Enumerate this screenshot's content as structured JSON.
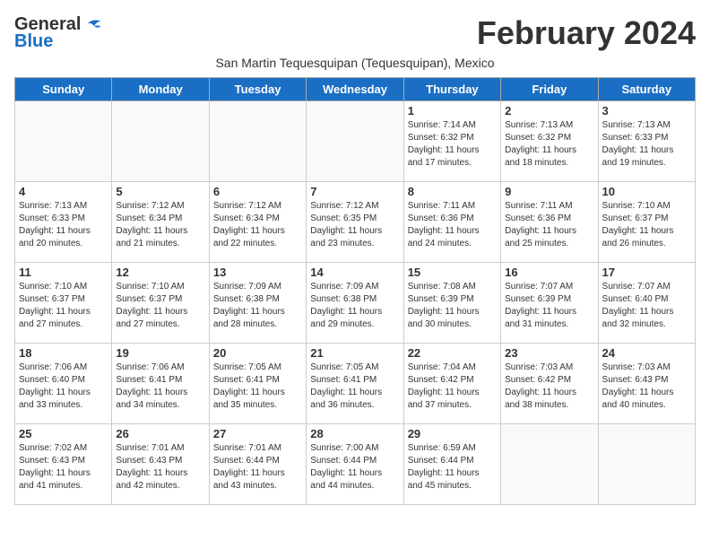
{
  "logo": {
    "general": "General",
    "blue": "Blue"
  },
  "title": "February 2024",
  "subtitle": "San Martin Tequesquipan (Tequesquipan), Mexico",
  "days_of_week": [
    "Sunday",
    "Monday",
    "Tuesday",
    "Wednesday",
    "Thursday",
    "Friday",
    "Saturday"
  ],
  "weeks": [
    [
      {
        "day": "",
        "info": ""
      },
      {
        "day": "",
        "info": ""
      },
      {
        "day": "",
        "info": ""
      },
      {
        "day": "",
        "info": ""
      },
      {
        "day": "1",
        "info": "Sunrise: 7:14 AM\nSunset: 6:32 PM\nDaylight: 11 hours\nand 17 minutes."
      },
      {
        "day": "2",
        "info": "Sunrise: 7:13 AM\nSunset: 6:32 PM\nDaylight: 11 hours\nand 18 minutes."
      },
      {
        "day": "3",
        "info": "Sunrise: 7:13 AM\nSunset: 6:33 PM\nDaylight: 11 hours\nand 19 minutes."
      }
    ],
    [
      {
        "day": "4",
        "info": "Sunrise: 7:13 AM\nSunset: 6:33 PM\nDaylight: 11 hours\nand 20 minutes."
      },
      {
        "day": "5",
        "info": "Sunrise: 7:12 AM\nSunset: 6:34 PM\nDaylight: 11 hours\nand 21 minutes."
      },
      {
        "day": "6",
        "info": "Sunrise: 7:12 AM\nSunset: 6:34 PM\nDaylight: 11 hours\nand 22 minutes."
      },
      {
        "day": "7",
        "info": "Sunrise: 7:12 AM\nSunset: 6:35 PM\nDaylight: 11 hours\nand 23 minutes."
      },
      {
        "day": "8",
        "info": "Sunrise: 7:11 AM\nSunset: 6:36 PM\nDaylight: 11 hours\nand 24 minutes."
      },
      {
        "day": "9",
        "info": "Sunrise: 7:11 AM\nSunset: 6:36 PM\nDaylight: 11 hours\nand 25 minutes."
      },
      {
        "day": "10",
        "info": "Sunrise: 7:10 AM\nSunset: 6:37 PM\nDaylight: 11 hours\nand 26 minutes."
      }
    ],
    [
      {
        "day": "11",
        "info": "Sunrise: 7:10 AM\nSunset: 6:37 PM\nDaylight: 11 hours\nand 27 minutes."
      },
      {
        "day": "12",
        "info": "Sunrise: 7:10 AM\nSunset: 6:37 PM\nDaylight: 11 hours\nand 27 minutes."
      },
      {
        "day": "13",
        "info": "Sunrise: 7:09 AM\nSunset: 6:38 PM\nDaylight: 11 hours\nand 28 minutes."
      },
      {
        "day": "14",
        "info": "Sunrise: 7:09 AM\nSunset: 6:38 PM\nDaylight: 11 hours\nand 29 minutes."
      },
      {
        "day": "15",
        "info": "Sunrise: 7:08 AM\nSunset: 6:39 PM\nDaylight: 11 hours\nand 30 minutes."
      },
      {
        "day": "16",
        "info": "Sunrise: 7:07 AM\nSunset: 6:39 PM\nDaylight: 11 hours\nand 31 minutes."
      },
      {
        "day": "17",
        "info": "Sunrise: 7:07 AM\nSunset: 6:40 PM\nDaylight: 11 hours\nand 32 minutes."
      }
    ],
    [
      {
        "day": "18",
        "info": "Sunrise: 7:06 AM\nSunset: 6:40 PM\nDaylight: 11 hours\nand 33 minutes."
      },
      {
        "day": "19",
        "info": "Sunrise: 7:06 AM\nSunset: 6:41 PM\nDaylight: 11 hours\nand 34 minutes."
      },
      {
        "day": "20",
        "info": "Sunrise: 7:05 AM\nSunset: 6:41 PM\nDaylight: 11 hours\nand 35 minutes."
      },
      {
        "day": "21",
        "info": "Sunrise: 7:05 AM\nSunset: 6:41 PM\nDaylight: 11 hours\nand 36 minutes."
      },
      {
        "day": "22",
        "info": "Sunrise: 7:04 AM\nSunset: 6:42 PM\nDaylight: 11 hours\nand 37 minutes."
      },
      {
        "day": "23",
        "info": "Sunrise: 7:03 AM\nSunset: 6:42 PM\nDaylight: 11 hours\nand 38 minutes."
      },
      {
        "day": "24",
        "info": "Sunrise: 7:03 AM\nSunset: 6:43 PM\nDaylight: 11 hours\nand 40 minutes."
      }
    ],
    [
      {
        "day": "25",
        "info": "Sunrise: 7:02 AM\nSunset: 6:43 PM\nDaylight: 11 hours\nand 41 minutes."
      },
      {
        "day": "26",
        "info": "Sunrise: 7:01 AM\nSunset: 6:43 PM\nDaylight: 11 hours\nand 42 minutes."
      },
      {
        "day": "27",
        "info": "Sunrise: 7:01 AM\nSunset: 6:44 PM\nDaylight: 11 hours\nand 43 minutes."
      },
      {
        "day": "28",
        "info": "Sunrise: 7:00 AM\nSunset: 6:44 PM\nDaylight: 11 hours\nand 44 minutes."
      },
      {
        "day": "29",
        "info": "Sunrise: 6:59 AM\nSunset: 6:44 PM\nDaylight: 11 hours\nand 45 minutes."
      },
      {
        "day": "",
        "info": ""
      },
      {
        "day": "",
        "info": ""
      }
    ]
  ]
}
